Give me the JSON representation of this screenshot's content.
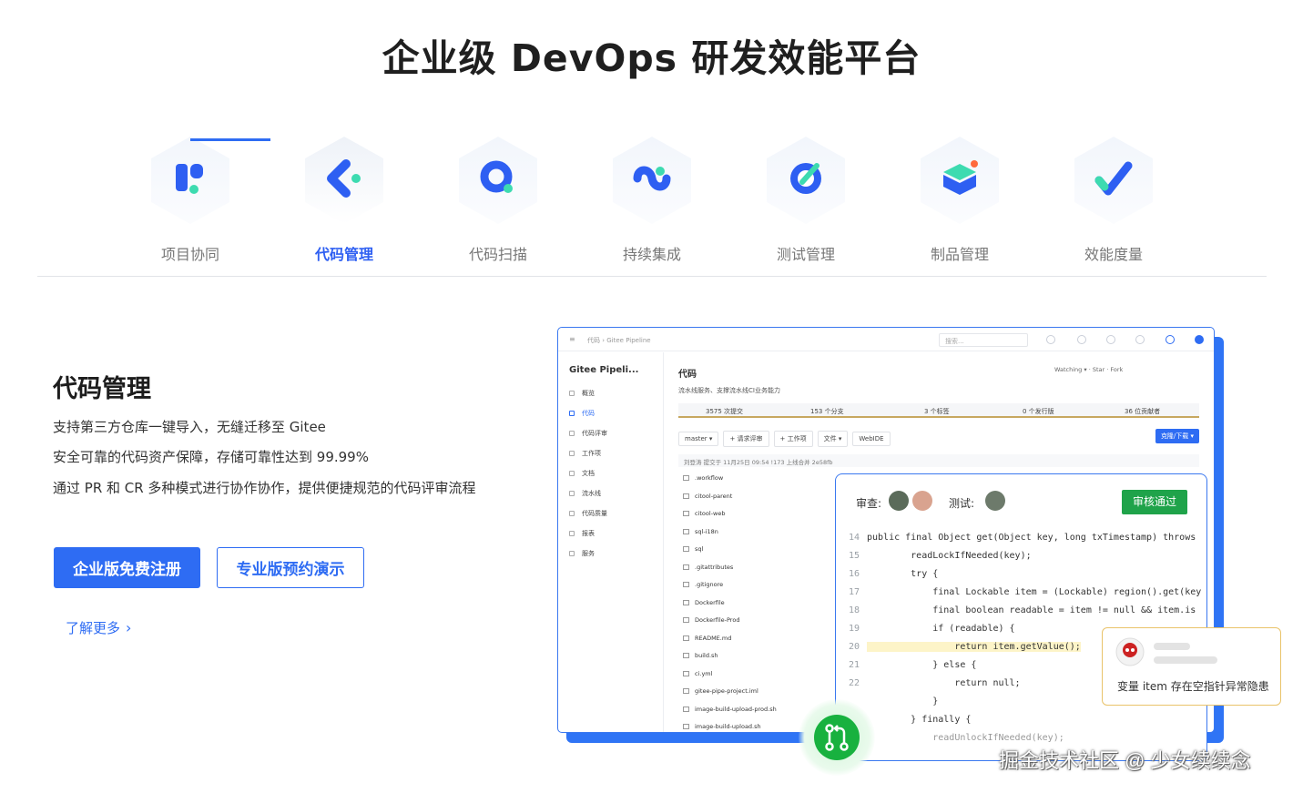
{
  "header": {
    "title": "企业级 DevOps 研发效能平台"
  },
  "tabs": [
    {
      "label": "项目协同",
      "icon": "project-icon"
    },
    {
      "label": "代码管理",
      "icon": "code-icon",
      "active": true
    },
    {
      "label": "代码扫描",
      "icon": "scan-icon"
    },
    {
      "label": "持续集成",
      "icon": "ci-icon"
    },
    {
      "label": "测试管理",
      "icon": "test-icon"
    },
    {
      "label": "制品管理",
      "icon": "artifact-icon"
    },
    {
      "label": "效能度量",
      "icon": "metrics-icon"
    }
  ],
  "section": {
    "title": "代码管理",
    "features": [
      "支持第三方仓库一键导入，无缝迁移至 Gitee",
      "安全可靠的代码资产保障，存储可靠性达到 99.99%",
      "通过 PR 和 CR 多种模式进行协作协作，提供便捷规范的代码评审流程"
    ],
    "primary_button": "企业版免费注册",
    "secondary_button": "专业版预约演示",
    "learn_more": "了解更多"
  },
  "mock": {
    "breadcrumb": "代码 › Gitee Pipeline",
    "search_placeholder": "搜索...",
    "repo_name": "Gitee Pipeli...",
    "sidebar": [
      "概览",
      "代码",
      "代码评审",
      "工作项",
      "文档",
      "流水线",
      "代码质量",
      "报表",
      "服务"
    ],
    "title": "代码",
    "desc": "流水线服务、支撑流水线CI业务能力",
    "watch": "Watching",
    "star": "Star",
    "fork": "Fork",
    "stats": [
      "3575 次提交",
      "153 个分支",
      "3 个标签",
      "0 个发行版",
      "36 位贡献者"
    ],
    "toolbar": [
      "master ▾",
      "+ 请求评审",
      "+ 工作项",
      "文件 ▾",
      "WebIDE"
    ],
    "download": "克隆/下载 ▾",
    "commit": "刘登涛 提交于 11月25日 09:54   !173 上线合并  2e58fb",
    "files": [
      ".workflow",
      "citool-parent",
      "citool-web",
      "sql-i18n",
      "sql",
      ".gitattributes",
      ".gitignore",
      "Dockerfile",
      "Dockerfile-Prod",
      "README.md",
      "build.sh",
      "ci.yml",
      "gitee-pipe-project.iml",
      "image-build-upload-prod.sh",
      "image-build-upload.sh"
    ]
  },
  "review": {
    "reviewer_label": "审查:",
    "tester_label": "测试:",
    "approve_button": "审核通过",
    "code": [
      {
        "n": "14",
        "t": "public final Object get(Object key, long txTimestamp) throws"
      },
      {
        "n": "15",
        "t": "        readLockIfNeeded(key);"
      },
      {
        "n": "16",
        "t": "        try {"
      },
      {
        "n": "17",
        "t": "            final Lockable item = (Lockable) region().get(key"
      },
      {
        "n": "18",
        "t": "            final boolean readable = item != null && item.is"
      },
      {
        "n": "19",
        "t": "            if (readable) {"
      },
      {
        "n": "20",
        "t": "                return item.getValue();"
      },
      {
        "n": "21",
        "t": "            } else {"
      },
      {
        "n": "22",
        "t": "                return null;"
      },
      {
        "n": "",
        "t": "            }"
      },
      {
        "n": "",
        "t": "        } finally {"
      },
      {
        "n": "",
        "t": "            readUnlockIfNeeded(key);"
      }
    ],
    "comment": "变量 item 存在空指针异常隐患"
  },
  "watermark": "掘金技术社区 @ 少女续续念",
  "colors": {
    "accent": "#2e6cf3",
    "approve": "#1fa34a",
    "brand_teal": "#3ddbb0"
  }
}
